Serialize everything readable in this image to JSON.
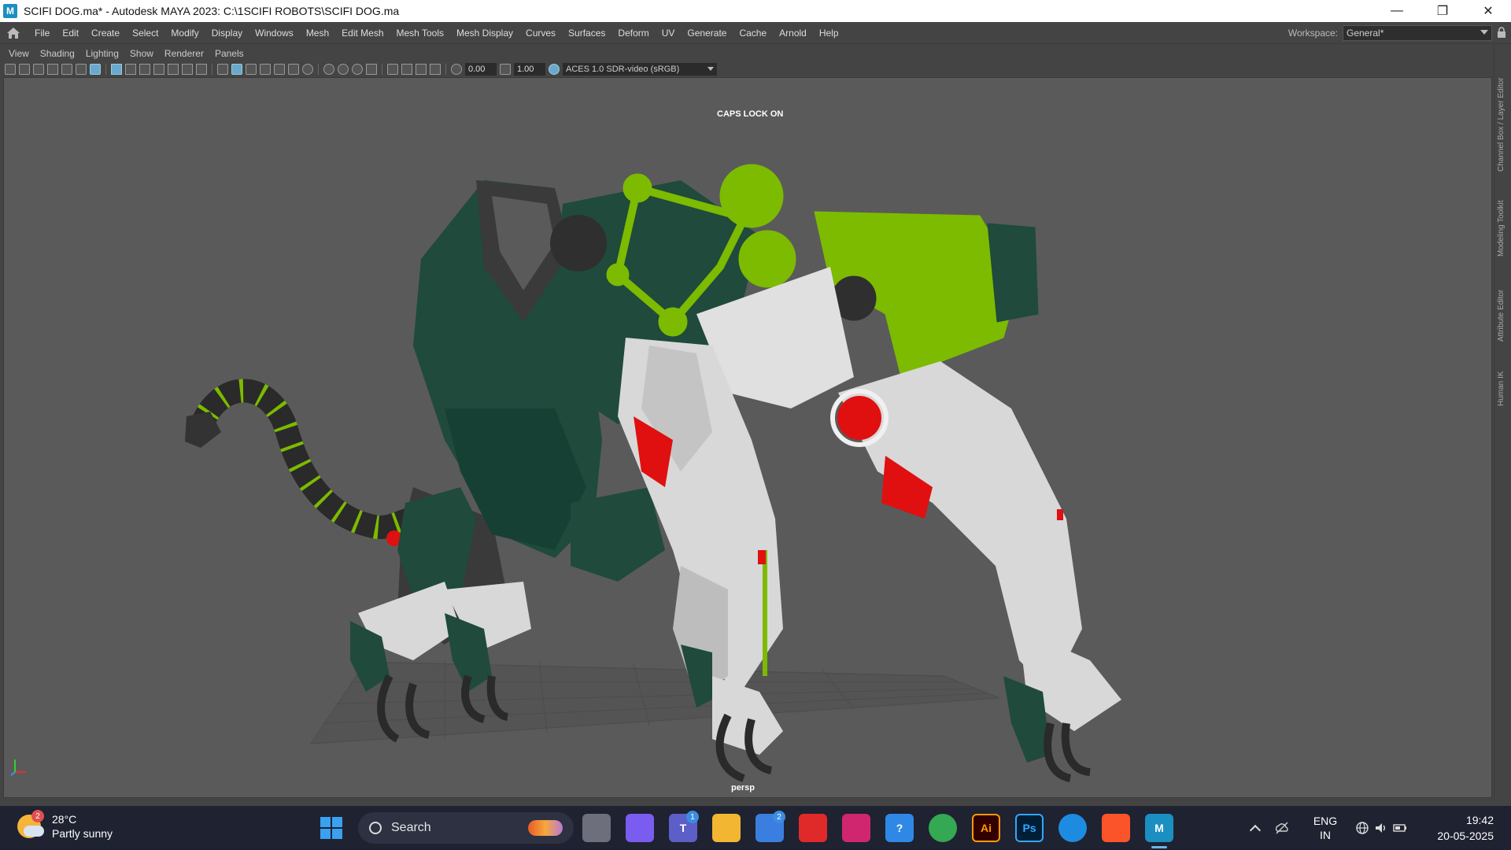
{
  "window": {
    "title": "SCIFI DOG.ma* - Autodesk MAYA 2023: C:\\1SCIFI ROBOTS\\SCIFI DOG.ma",
    "app_icon_letter": "M",
    "minimize_glyph": "—",
    "restore_glyph": "❐",
    "close_glyph": "✕"
  },
  "menubar": {
    "items": [
      "File",
      "Edit",
      "Create",
      "Select",
      "Modify",
      "Display",
      "Windows",
      "Mesh",
      "Edit Mesh",
      "Mesh Tools",
      "Mesh Display",
      "Curves",
      "Surfaces",
      "Deform",
      "UV",
      "Generate",
      "Cache",
      "Arnold",
      "Help"
    ],
    "workspace_label": "Workspace:",
    "workspace_value": "General*"
  },
  "panel_menu": {
    "items": [
      "View",
      "Shading",
      "Lighting",
      "Show",
      "Renderer",
      "Panels"
    ]
  },
  "panel_toolbar": {
    "exposure": "0.00",
    "gamma": "1.00",
    "color_space": "ACES 1.0 SDR-video (sRGB)"
  },
  "viewport": {
    "caps_lock_text": "CAPS LOCK ON",
    "camera_label": "persp",
    "colors": {
      "background": "#5a5a5a",
      "body_green": "#1f4a3c",
      "lime": "#7cbb00",
      "white_armor": "#d8d8d8",
      "red_light": "#e01010",
      "gray_metal": "#3a3a3a"
    }
  },
  "side_tabs": [
    "Channel Box / Layer Editor",
    "Modeling Toolkit",
    "Attribute Editor",
    "Human IK"
  ],
  "taskbar": {
    "weather_badge": "2",
    "temperature": "28°C",
    "condition": "Partly sunny",
    "search_text": "Search",
    "apps": [
      {
        "name": "task-view",
        "color": "#6d6f7d",
        "label": "",
        "count": ""
      },
      {
        "name": "copilot",
        "color": "#7a5cf0",
        "label": "",
        "count": ""
      },
      {
        "name": "teams",
        "color": "#5b5fc7",
        "label": "T",
        "count": "1"
      },
      {
        "name": "file-explorer",
        "color": "#f2b632",
        "label": "",
        "count": ""
      },
      {
        "name": "microsoft-store",
        "color": "#3a7ee0",
        "label": "",
        "count": "2"
      },
      {
        "name": "red-app",
        "color": "#e02a2a",
        "label": "",
        "count": ""
      },
      {
        "name": "forza",
        "color": "#d02670",
        "label": "",
        "count": ""
      },
      {
        "name": "get-help",
        "color": "#2f88e6",
        "label": "?",
        "count": ""
      },
      {
        "name": "chrome",
        "color": "#34a853",
        "label": "",
        "count": ""
      },
      {
        "name": "illustrator",
        "color": "#330000",
        "label": "Ai",
        "count": ""
      },
      {
        "name": "photoshop",
        "color": "#001e36",
        "label": "Ps",
        "count": ""
      },
      {
        "name": "edge",
        "color": "#1d8ce0",
        "label": "",
        "count": ""
      },
      {
        "name": "brave",
        "color": "#fb542b",
        "label": "",
        "count": ""
      },
      {
        "name": "maya",
        "color": "#1c8fc2",
        "label": "M",
        "count": ""
      }
    ],
    "language": "ENG",
    "region": "IN",
    "time": "19:42",
    "date": "20-05-2025"
  }
}
